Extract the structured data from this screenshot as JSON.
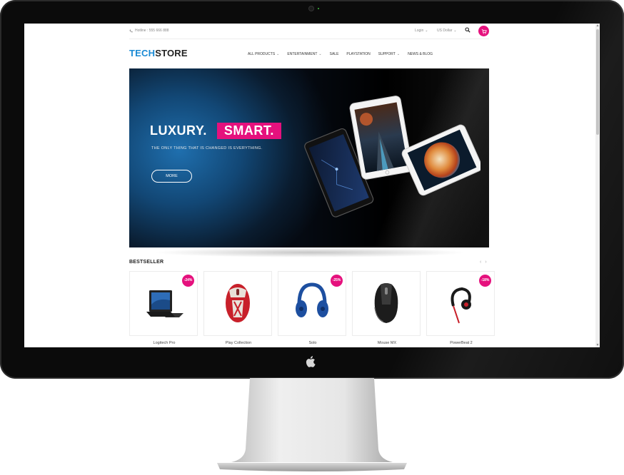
{
  "topbar": {
    "hotline": "Hotline : 555 666 888",
    "login": "Login",
    "currency": "US Dollar"
  },
  "logo": {
    "part1": "TECH",
    "part2": "STORE"
  },
  "nav": [
    {
      "label": "ALL PRODUCTS",
      "has_dropdown": true
    },
    {
      "label": "ENTERTAINMENT",
      "has_dropdown": true
    },
    {
      "label": "SALE",
      "has_dropdown": false
    },
    {
      "label": "PLAYSTATION",
      "has_dropdown": false
    },
    {
      "label": "SUPPORT",
      "has_dropdown": true
    },
    {
      "label": "NEWS & BLOG",
      "has_dropdown": false
    }
  ],
  "hero": {
    "title_white": "LUXURY.",
    "title_highlight": "SMART.",
    "subtitle": "THE ONLY THING THAT IS CHANGED IS EVERYTHING.",
    "button": "MORE"
  },
  "bestseller": {
    "title": "BESTSELLER",
    "products": [
      {
        "name": "Logitech Pro",
        "badge": "-24%",
        "icon": "tablet-keyboard-icon"
      },
      {
        "name": "Play Collection",
        "badge": "",
        "icon": "mouse-icon"
      },
      {
        "name": "Solo",
        "badge": "-25%",
        "icon": "headphones-icon"
      },
      {
        "name": "Mouse MX",
        "badge": "",
        "icon": "mouse-icon"
      },
      {
        "name": "PowerBeat 2",
        "badge": "-18%",
        "icon": "earphone-icon"
      }
    ]
  },
  "colors": {
    "accent": "#e5117d",
    "logo_blue": "#1a8ad4",
    "bezel": "#0b0b0b"
  }
}
